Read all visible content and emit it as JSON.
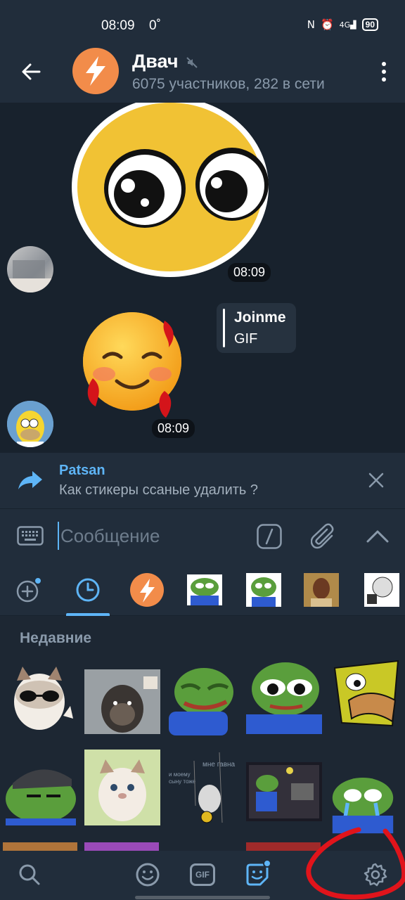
{
  "status_bar": {
    "time": "08:09",
    "temperature": "0˚",
    "network": "4G",
    "battery": "90"
  },
  "header": {
    "title": "Двач",
    "subtitle": "6075 участников, 282 в сети"
  },
  "messages": {
    "sticker1_time": "08:09",
    "gif_link_title": "Joinme",
    "gif_link_sub": "GIF",
    "sticker2_time": "08:09"
  },
  "reply": {
    "name": "Patsan",
    "text": "Как стикеры ссаные удалить ?"
  },
  "composer": {
    "placeholder": "Сообщение"
  },
  "sticker_panel": {
    "section_title": "Недавние"
  },
  "bottom_bar": {
    "gif_label": "GIF"
  },
  "colors": {
    "accent": "#5eb5f7",
    "background": "#1d2733",
    "header": "#212d3b",
    "annotation": "#e0141b"
  }
}
